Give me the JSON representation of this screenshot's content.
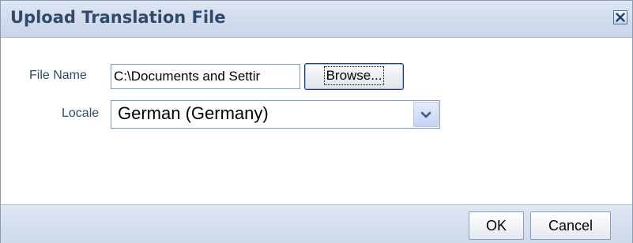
{
  "dialog": {
    "title": "Upload Translation File"
  },
  "form": {
    "file_name_label": "File Name",
    "file_name_value": "C:\\Documents and Settir",
    "browse_label": "Browse...",
    "locale_label": "Locale",
    "locale_value": "German (Germany)"
  },
  "footer": {
    "ok_label": "OK",
    "cancel_label": "Cancel"
  },
  "colors": {
    "title_text": "#2f4a6b",
    "header_bg": "#d2dced",
    "label_text": "#2f4a6b",
    "close_icon": "#1f3e75"
  },
  "icons": {
    "close": "close-icon",
    "dropdown": "chevron-down-icon"
  }
}
